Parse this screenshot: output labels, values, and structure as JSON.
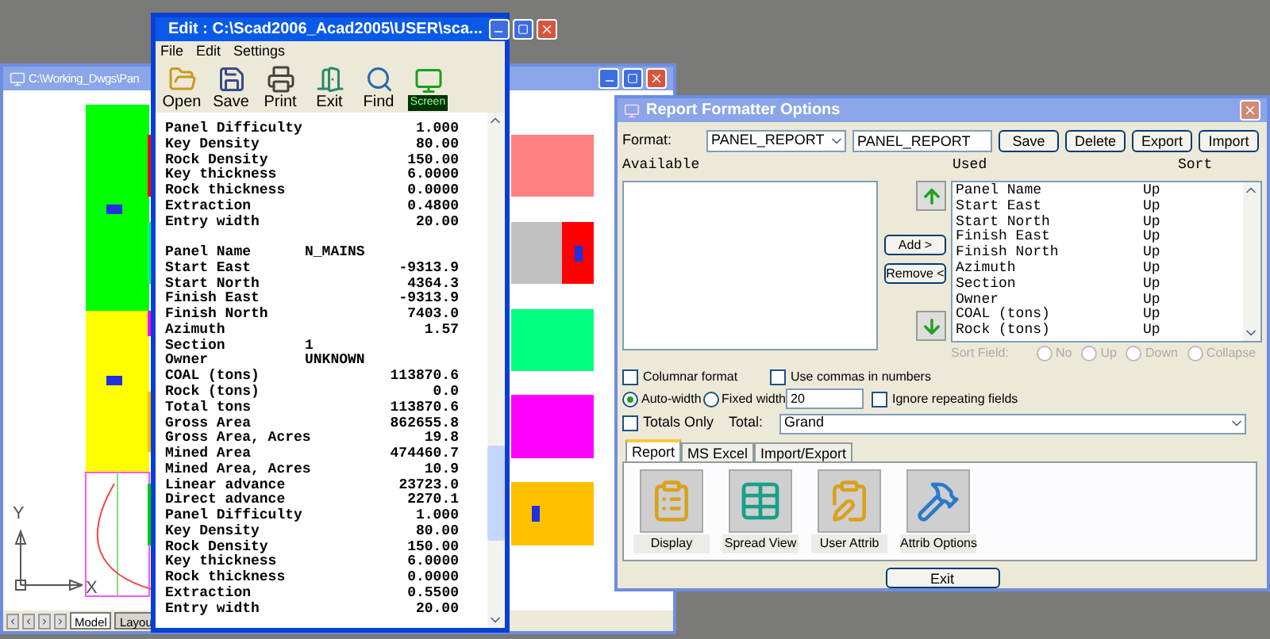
{
  "cad_window": {
    "title": "C:\\Working_Dwgs\\Pan",
    "axis_y": "Y",
    "axis_x": "X",
    "tabs": [
      {
        "label": "Model",
        "selected": true
      },
      {
        "label": "Layou",
        "selected": false
      }
    ]
  },
  "editor": {
    "title": "Edit : C:\\Scad2006_Acad2005\\USER\\sca...",
    "menu": [
      "File",
      "Edit",
      "Settings"
    ],
    "toolbar": [
      {
        "label": "Open",
        "kind": "open"
      },
      {
        "label": "Save",
        "kind": "save"
      },
      {
        "label": "Print",
        "kind": "print"
      },
      {
        "label": "Exit",
        "kind": "exit"
      },
      {
        "label": "Find",
        "kind": "find"
      },
      {
        "label": "Screen",
        "kind": "screen"
      }
    ],
    "lines": [
      {
        "label": "Panel Difficulty",
        "value": "1.000",
        "kind": "number"
      },
      {
        "label": "Key Density",
        "value": "80.00",
        "kind": "number"
      },
      {
        "label": "Rock Density",
        "value": "150.00",
        "kind": "number"
      },
      {
        "label": "Key thickness",
        "value": "6.0000",
        "kind": "number"
      },
      {
        "label": "Rock thickness",
        "value": "0.0000",
        "kind": "number"
      },
      {
        "label": "Extraction",
        "value": "0.4800",
        "kind": "number"
      },
      {
        "label": "Entry width",
        "value": "20.00",
        "kind": "number"
      },
      {
        "kind": "blank"
      },
      {
        "label": "Panel Name",
        "value": "N_MAINS",
        "kind": "text"
      },
      {
        "label": "Start East",
        "value": "-9313.9",
        "kind": "number"
      },
      {
        "label": "Start North",
        "value": "4364.3",
        "kind": "number"
      },
      {
        "label": "Finish East",
        "value": "-9313.9",
        "kind": "number"
      },
      {
        "label": "Finish North",
        "value": "7403.0",
        "kind": "number"
      },
      {
        "label": "Azimuth",
        "value": "1.57",
        "kind": "number"
      },
      {
        "label": "Section",
        "value": "1",
        "kind": "text"
      },
      {
        "label": "Owner",
        "value": "UNKNOWN",
        "kind": "text"
      },
      {
        "label": "COAL (tons)",
        "value": "113870.6",
        "kind": "number"
      },
      {
        "label": "Rock (tons)",
        "value": "0.0",
        "kind": "number"
      },
      {
        "label": "Total tons",
        "value": "113870.6",
        "kind": "number"
      },
      {
        "label": "Gross Area",
        "value": "862655.8",
        "kind": "number"
      },
      {
        "label": "Gross Area, Acres",
        "value": "19.8",
        "kind": "number"
      },
      {
        "label": "Mined Area",
        "value": "474460.7",
        "kind": "number"
      },
      {
        "label": "Mined Area, Acres",
        "value": "10.9",
        "kind": "number"
      },
      {
        "label": "Linear advance",
        "value": "23723.0",
        "kind": "number"
      },
      {
        "label": "Direct advance",
        "value": "2270.1",
        "kind": "number"
      },
      {
        "label": "Panel Difficulty",
        "value": "1.000",
        "kind": "number"
      },
      {
        "label": "Key Density",
        "value": "80.00",
        "kind": "number"
      },
      {
        "label": "Rock Density",
        "value": "150.00",
        "kind": "number"
      },
      {
        "label": "Key thickness",
        "value": "6.0000",
        "kind": "number"
      },
      {
        "label": "Rock thickness",
        "value": "0.0000",
        "kind": "number"
      },
      {
        "label": "Extraction",
        "value": "0.5500",
        "kind": "number"
      },
      {
        "label": "Entry width",
        "value": "20.00",
        "kind": "number"
      }
    ]
  },
  "report": {
    "title": "Report Formatter Options",
    "format_label": "Format:",
    "format_combo": "PANEL_REPORT",
    "format_name": "PANEL_REPORT",
    "buttons": [
      "Save",
      "Delete",
      "Export",
      "Import"
    ],
    "available_label": "Available",
    "used_label": "Used",
    "sort_label": "Sort",
    "add_button": "Add >",
    "remove_button": "Remove <",
    "used_items": [
      {
        "name": "Panel Name",
        "sort": "Up",
        "selected": false
      },
      {
        "name": "Start East",
        "sort": "Up",
        "selected": false
      },
      {
        "name": "Start North",
        "sort": "Up",
        "selected": false
      },
      {
        "name": "Finish East",
        "sort": "Up",
        "selected": false
      },
      {
        "name": "Finish North",
        "sort": "Up",
        "selected": false
      },
      {
        "name": "Azimuth",
        "sort": "Up",
        "selected": false
      },
      {
        "name": "Section",
        "sort": "Up",
        "selected": false
      },
      {
        "name": "Owner",
        "sort": "Up",
        "selected": false
      },
      {
        "name": "COAL (tons)",
        "sort": "Up",
        "selected": false
      },
      {
        "name": "Rock (tons)",
        "sort": "Up",
        "selected": false
      }
    ],
    "sort_field": {
      "label": "Sort Field:",
      "disabled": true,
      "options": [
        {
          "label": "No",
          "selected": false
        },
        {
          "label": "Up",
          "selected": false
        },
        {
          "label": "Down",
          "selected": false
        },
        {
          "label": "Collapse",
          "selected": false
        }
      ]
    },
    "columnar": {
      "label": "Columnar format",
      "checked": false
    },
    "commas": {
      "label": "Use commas in numbers",
      "checked": false
    },
    "width_modes": [
      {
        "label": "Auto-width",
        "selected": true
      },
      {
        "label": "Fixed width",
        "selected": false
      }
    ],
    "width_value": "20",
    "ignore_repeating": {
      "label": "Ignore repeating fields",
      "checked": false
    },
    "totals_only": {
      "label": "Totals Only",
      "checked": false
    },
    "total_label": "Total:",
    "total_value": "Grand",
    "tabs": [
      {
        "label": "Report",
        "selected": true
      },
      {
        "label": "MS Excel",
        "selected": false
      },
      {
        "label": "Import/Export",
        "selected": false
      }
    ],
    "tools": [
      {
        "label": "Display",
        "kind": "display"
      },
      {
        "label": "Spread View",
        "kind": "spread"
      },
      {
        "label": "User Attrib",
        "kind": "user"
      },
      {
        "label": "Attrib Options",
        "kind": "options"
      }
    ],
    "exit_button": "Exit"
  }
}
